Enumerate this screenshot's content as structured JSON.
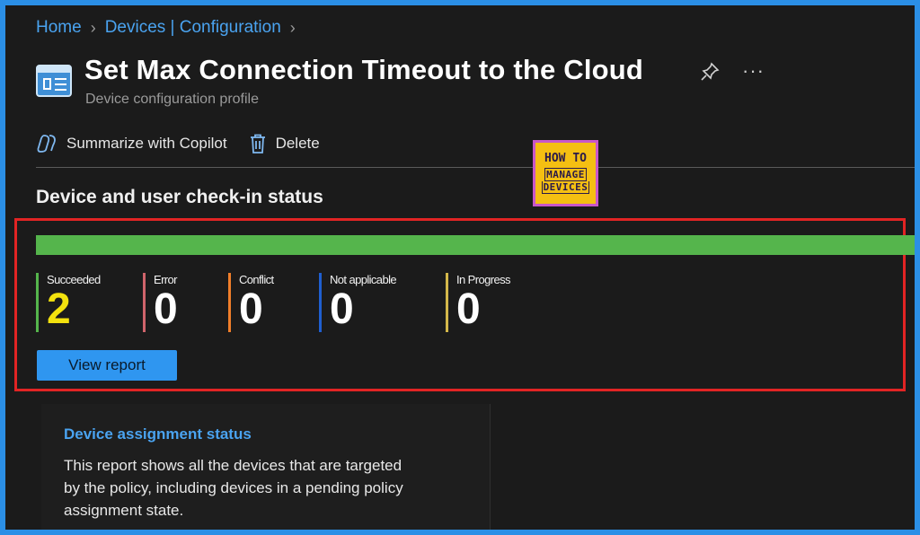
{
  "breadcrumb": {
    "items": [
      "Home",
      "Devices | Configuration"
    ]
  },
  "header": {
    "title": "Set Max Connection Timeout to the Cloud",
    "subtitle": "Device configuration profile",
    "more": "···"
  },
  "toolbar": {
    "copilot_label": "Summarize with Copilot",
    "delete_label": "Delete"
  },
  "logo": {
    "line1": "HOW TO",
    "line2": "MANAGE",
    "line3": "DEVICES"
  },
  "checkin": {
    "title": "Device and user check-in status",
    "stats": [
      {
        "label": "Succeeded",
        "count": "2",
        "color": "#55b54c"
      },
      {
        "label": "Error",
        "count": "0",
        "color": "#d0646b"
      },
      {
        "label": "Conflict",
        "count": "0",
        "color": "#f07e2a"
      },
      {
        "label": "Not applicable",
        "count": "0",
        "color": "#1f5fd0"
      },
      {
        "label": "In Progress",
        "count": "0",
        "color": "#d4b84a"
      }
    ],
    "view_report_label": "View report"
  },
  "assignment_card": {
    "title": "Device assignment status",
    "description": "This report shows all the devices that are targeted by the policy, including devices in a pending policy assignment state."
  },
  "colors": {
    "accent": "#4aa3f0",
    "success_bar": "#55b54c",
    "highlight": "#e22424",
    "button": "#2f96f0"
  }
}
